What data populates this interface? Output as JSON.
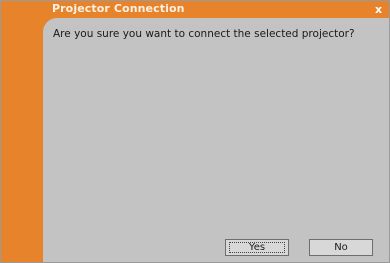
{
  "dialog": {
    "title": "Projector Connection",
    "close_glyph": "x",
    "message": "Are you sure you want to connect the selected projector?",
    "buttons": {
      "yes": "Yes",
      "no": "No"
    },
    "colors": {
      "accent": "#e7842b",
      "body": "#c3c3c3"
    }
  }
}
